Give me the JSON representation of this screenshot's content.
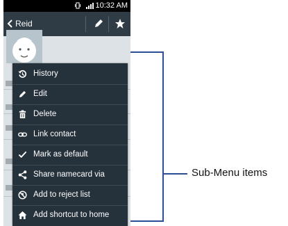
{
  "status_bar": {
    "time": "10:32 AM",
    "signal_icon": "signal-bars-icon",
    "vibrate_icon": "vibrate-icon"
  },
  "action_bar": {
    "title": "Reid",
    "back_icon": "chevron-left-icon",
    "edit_icon": "pencil-icon",
    "favorite_icon": "star-icon"
  },
  "menu": {
    "items": [
      {
        "label": "History",
        "icon": "history-icon"
      },
      {
        "label": "Edit",
        "icon": "pencil-icon"
      },
      {
        "label": "Delete",
        "icon": "trash-icon"
      },
      {
        "label": "Link contact",
        "icon": "link-icon"
      },
      {
        "label": "Mark as default",
        "icon": "checkmark-icon"
      },
      {
        "label": "Share namecard via",
        "icon": "share-icon"
      },
      {
        "label": "Add to reject list",
        "icon": "reject-icon"
      },
      {
        "label": "Add shortcut to home",
        "icon": "home-icon"
      }
    ]
  },
  "callout": {
    "label": "Sub-Menu items",
    "color": "#2c4e95"
  }
}
